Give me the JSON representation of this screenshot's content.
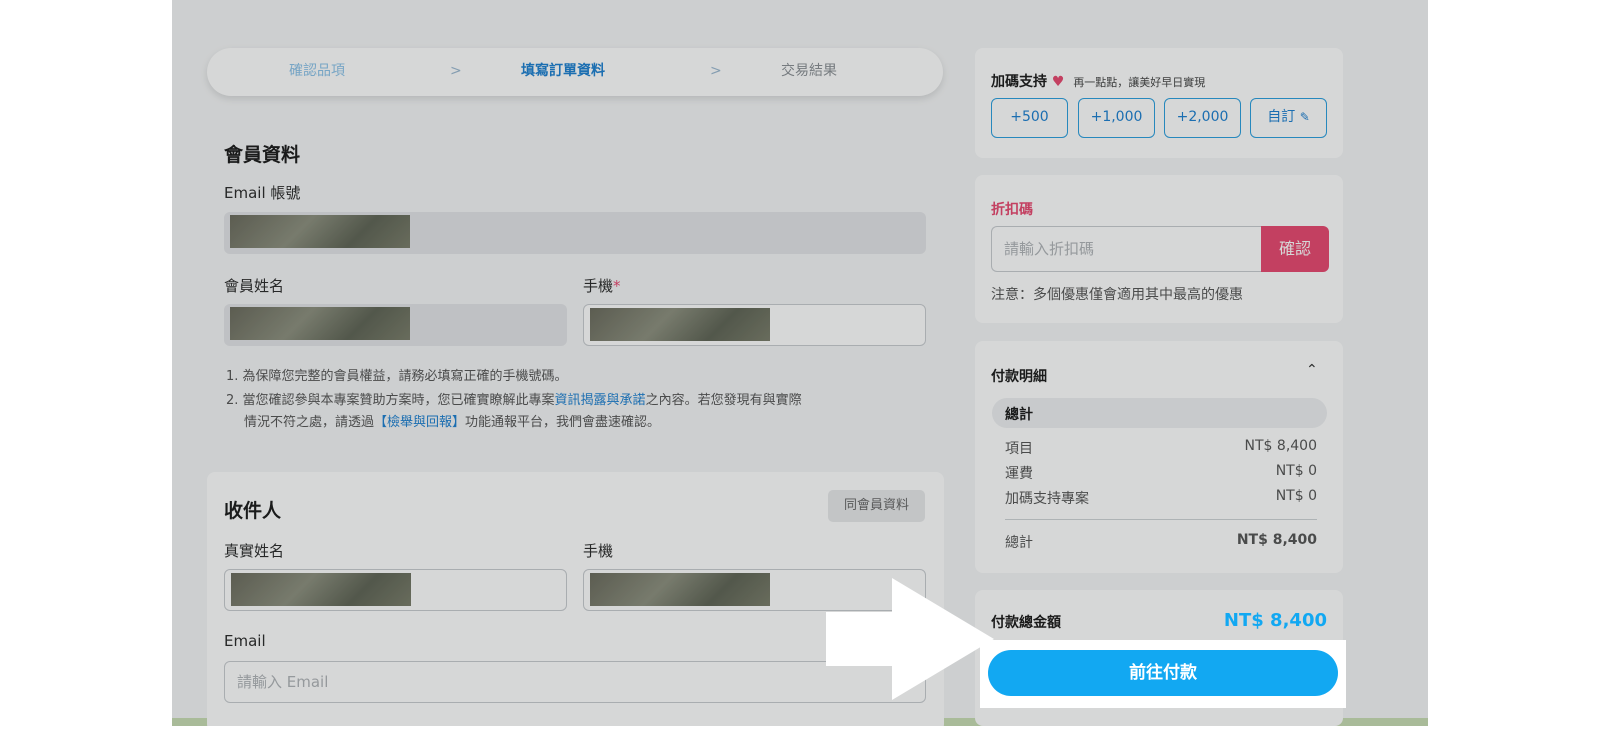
{
  "stepper": {
    "steps": [
      "確認品項",
      "填寫訂單資料",
      "交易結果"
    ],
    "active_index": 1,
    "separator": ">"
  },
  "member": {
    "title": "會員資料",
    "email_label": "Email 帳號",
    "name_label": "會員姓名",
    "phone_label": "手機",
    "required_mark": "*",
    "notes": {
      "n1": "1. 為保障您完整的會員權益，請務必填寫正確的手機號碼。",
      "n2_a": "2. 當您確認參與本專案贊助方案時，您已確實瞭解此專案",
      "n2_link": "資訊揭露與承諾",
      "n2_b": "之內容。若您發現有與實際",
      "n2_c": "情況不符之處，請透過",
      "n2_link2": "【檢舉與回報】",
      "n2_d": "功能通報平台，我們會盡速確認。"
    }
  },
  "recipient": {
    "title": "收件人",
    "same_button": "同會員資料",
    "name_label": "真實姓名",
    "phone_label": "手機",
    "email_label": "Email",
    "email_placeholder": "請輸入 Email"
  },
  "support": {
    "title": "加碼支持",
    "subtitle": "再一點點，讓美好早日實現",
    "amounts": [
      "+500",
      "+1,000",
      "+2,000",
      "自訂"
    ]
  },
  "coupon": {
    "title": "折扣碼",
    "placeholder": "請輸入折扣碼",
    "button": "確認",
    "note": "注意：多個優惠僅會適用其中最高的優惠"
  },
  "payment_detail": {
    "title": "付款明細",
    "section": "總計",
    "rows": [
      {
        "label": "項目",
        "value": "NT$ 8,400"
      },
      {
        "label": "運費",
        "value": "NT$ 0"
      },
      {
        "label": "加碼支持專案",
        "value": "NT$ 0"
      }
    ],
    "total_label": "總計",
    "total_value": "NT$ 8,400"
  },
  "checkout": {
    "total_label": "付款總金額",
    "total_value": "NT$ 8,400",
    "pay_button": "前往付款"
  },
  "colors": {
    "accent": "#1b7fd1",
    "pay_button": "#12a8f2",
    "coupon_button": "#e8476f"
  }
}
